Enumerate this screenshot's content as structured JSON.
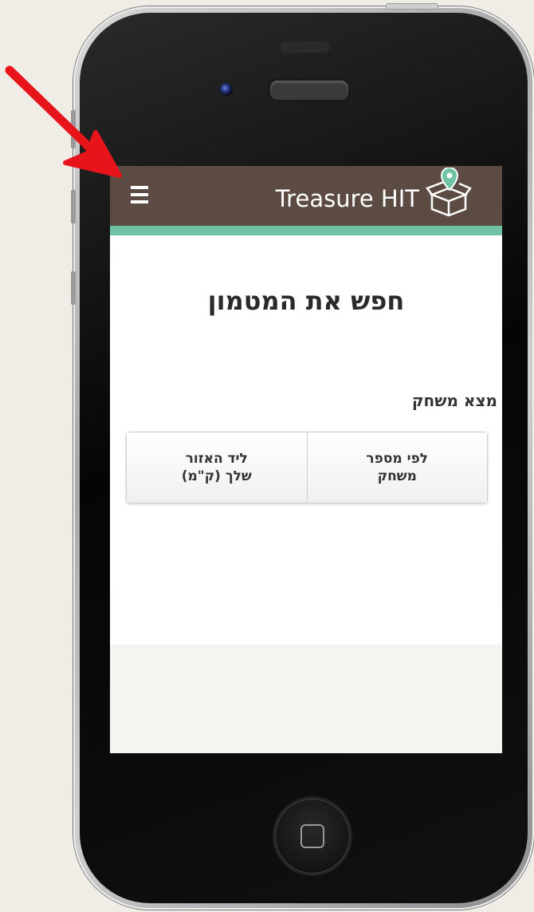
{
  "app": {
    "title": "Treasure HIT",
    "accent_color": "#6fc2a3",
    "header_color": "#5b4b42"
  },
  "header": {
    "menu_icon": "hamburger-icon",
    "logo_icon": "treasure-box-pin-icon"
  },
  "main": {
    "page_title": "חפש את המטמון",
    "section_label": "מצא משחק",
    "buttons": [
      {
        "line1": "לפי מספר",
        "line2": "משחק"
      },
      {
        "line1": "ליד האזור",
        "line2": "שלך (ק\"מ)"
      }
    ]
  },
  "annotation": {
    "arrow_color": "#e8141b",
    "icon": "red-arrow-icon"
  }
}
